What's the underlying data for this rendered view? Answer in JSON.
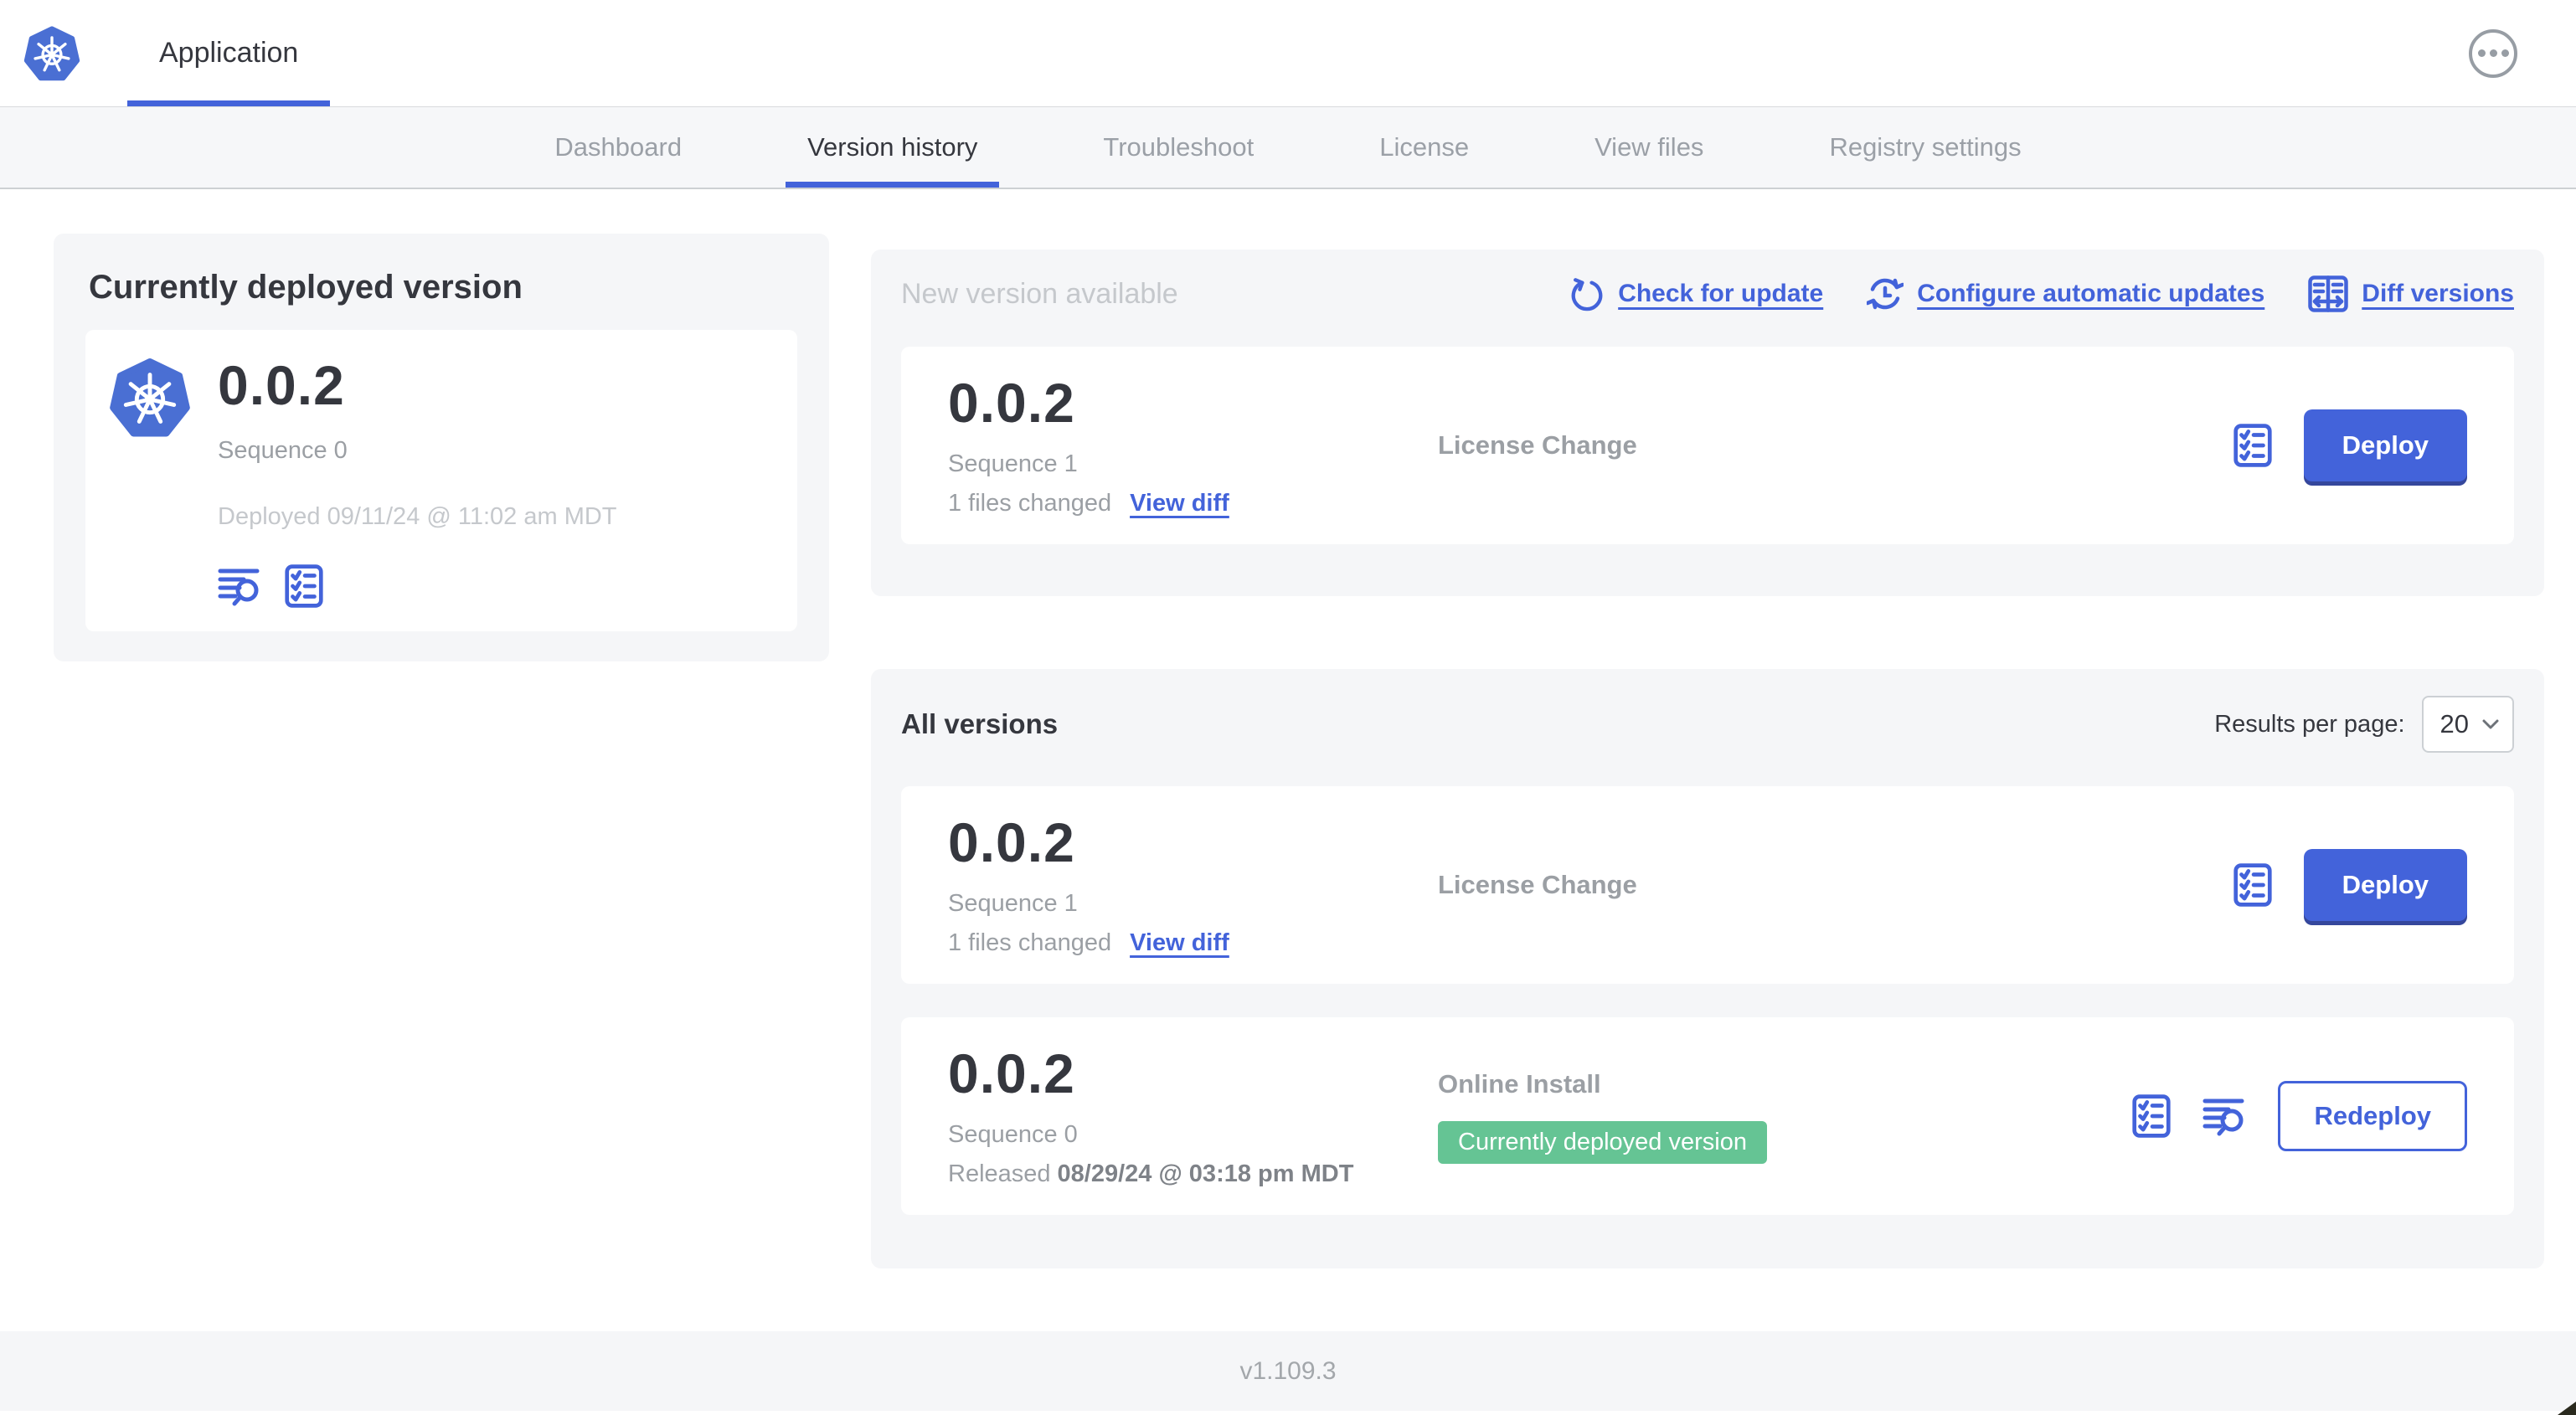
{
  "header": {
    "app_title": "Application"
  },
  "nav": {
    "tabs": [
      {
        "label": "Dashboard"
      },
      {
        "label": "Version history"
      },
      {
        "label": "Troubleshoot"
      },
      {
        "label": "License"
      },
      {
        "label": "View files"
      },
      {
        "label": "Registry settings"
      }
    ],
    "active_tab": "Version history"
  },
  "current_version": {
    "heading": "Currently deployed version",
    "version": "0.0.2",
    "sequence": "Sequence 0",
    "deployed": "Deployed 09/11/24 @ 11:02 am MDT"
  },
  "new_version": {
    "heading": "New version available",
    "check_for_update": "Check for update",
    "configure_auto_updates": "Configure automatic updates",
    "diff_versions": "Diff versions",
    "row": {
      "version": "0.0.2",
      "sequence": "Sequence 1",
      "files_changed": "1 files changed",
      "view_diff": "View diff",
      "source": "License Change",
      "action": "Deploy"
    }
  },
  "all_versions": {
    "heading": "All versions",
    "results_per_page_label": "Results per page:",
    "results_per_page_value": "20",
    "rows": [
      {
        "version": "0.0.2",
        "sequence": "Sequence 1",
        "files_changed": "1 files changed",
        "view_diff": "View diff",
        "source": "License Change",
        "action": "Deploy"
      },
      {
        "version": "0.0.2",
        "sequence": "Sequence 0",
        "released_prefix": "Released",
        "released_date": "08/29/24 @ 03:18 pm MDT",
        "source": "Online Install",
        "badge": "Currently deployed version",
        "action": "Redeploy"
      }
    ]
  },
  "footer": {
    "version_label": "v1.109.3"
  },
  "colors": {
    "accent_blue": "#4363da",
    "logo_blue": "#4a6fd3",
    "badge_green": "#65c494",
    "muted_text": "#9b9fa4",
    "light_text": "#c5c8cc",
    "section_bg": "#f5f6f8"
  }
}
